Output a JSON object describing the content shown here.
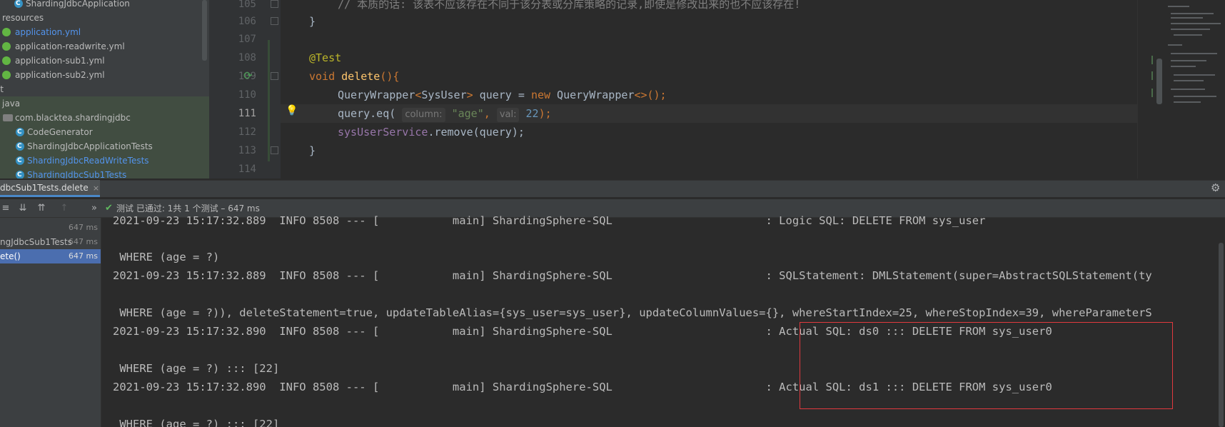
{
  "project_tree": {
    "items": [
      {
        "label": "ShardingJdbcApplication",
        "icon": "class-icon",
        "color": "#bbbbbb"
      },
      {
        "label": "resources",
        "icon": "",
        "color": "#bbbbbb"
      },
      {
        "label": "application.yml",
        "icon": "spring-config-icon",
        "color": "#5394ec"
      },
      {
        "label": "application-readwrite.yml",
        "icon": "spring-config-icon",
        "color": "#bbbbbb"
      },
      {
        "label": "application-sub1.yml",
        "icon": "spring-config-icon",
        "color": "#bbbbbb"
      },
      {
        "label": "application-sub2.yml",
        "icon": "spring-config-icon",
        "color": "#bbbbbb"
      },
      {
        "label": "st",
        "icon": "",
        "color": "#bbbbbb"
      },
      {
        "label": "java",
        "icon": "",
        "color": "#bbbbbb"
      },
      {
        "label": "com.blacktea.shardingjdbc",
        "icon": "package-icon",
        "color": "#bbbbbb"
      },
      {
        "label": "CodeGenerator",
        "icon": "class-icon",
        "color": "#bbbbbb"
      },
      {
        "label": "ShardingJdbcApplicationTests",
        "icon": "class-icon",
        "color": "#bbbbbb"
      },
      {
        "label": "ShardingJdbcReadWriteTests",
        "icon": "class-icon",
        "color": "#5394ec"
      },
      {
        "label": "ShardingJdbcSub1Tests",
        "icon": "class-icon",
        "color": "#5394ec"
      }
    ]
  },
  "editor": {
    "line_numbers": [
      "105",
      "106",
      "107",
      "108",
      "109",
      "110",
      "111",
      "112",
      "113",
      "114"
    ],
    "current_line": "111",
    "comment": "// 本质的话: 该表不应该存在不同于该分表或分库策略的记录,即使是修改出来的也不应该存在!",
    "close_brace": "}",
    "annotation": "@Test",
    "kw_void": "void",
    "method_name": "delete",
    "method_parens": "(){",
    "line110": {
      "type": "QueryWrapper",
      "generic_open": "<",
      "generic_type": "SysUser",
      "generic_close": ">",
      "var": " query = ",
      "kw_new": "new",
      "ctor": " QueryWrapper",
      "diamond": "<>",
      "end": "();"
    },
    "line111": {
      "call": "query.eq(",
      "hint_column": "column:",
      "arg1": "\"age\"",
      "comma": ", ",
      "hint_val": "val:",
      "arg2": "22",
      "end": ");"
    },
    "line112": {
      "field": "sysUserService",
      "call": ".remove(query);"
    },
    "method_close": "}"
  },
  "run_panel": {
    "tab_label": "dbcSub1Tests.delete",
    "tab_close": "×",
    "status": "测试 已通过: 1共 1 个测试 – 647 ms",
    "test_tree": [
      {
        "name": "",
        "duration": "647 ms"
      },
      {
        "name": "ngJdbcSub1Tests",
        "duration": "647 ms"
      },
      {
        "name": "ete()",
        "duration": "647 ms",
        "selected": true
      }
    ],
    "console_lines": [
      "2021-09-23 15:17:32.889  INFO 8508 --- [           main] ShardingSphere-SQL                       : Logic SQL: DELETE FROM sys_user",
      " WHERE (age = ?)",
      "2021-09-23 15:17:32.889  INFO 8508 --- [           main] ShardingSphere-SQL                       : SQLStatement: DMLStatement(super=AbstractSQLStatement(ty",
      " WHERE (age = ?)), deleteStatement=true, updateTableAlias={sys_user=sys_user}, updateColumnValues={}, whereStartIndex=25, whereStopIndex=39, whereParameterS",
      "2021-09-23 15:17:32.890  INFO 8508 --- [           main] ShardingSphere-SQL                       : Actual SQL: ds0 ::: DELETE FROM sys_user0",
      " WHERE (age = ?) ::: [22]",
      "2021-09-23 15:17:32.890  INFO 8508 --- [           main] ShardingSphere-SQL                       : Actual SQL: ds1 ::: DELETE FROM sys_user0",
      " WHERE (age = ?) ::: [22]"
    ]
  },
  "colors": {
    "background": "#2b2b2b",
    "panel": "#3c3f41",
    "selection": "#4b6eaf",
    "highlight_box": "#e0393e",
    "pass_green": "#5fb85f"
  }
}
